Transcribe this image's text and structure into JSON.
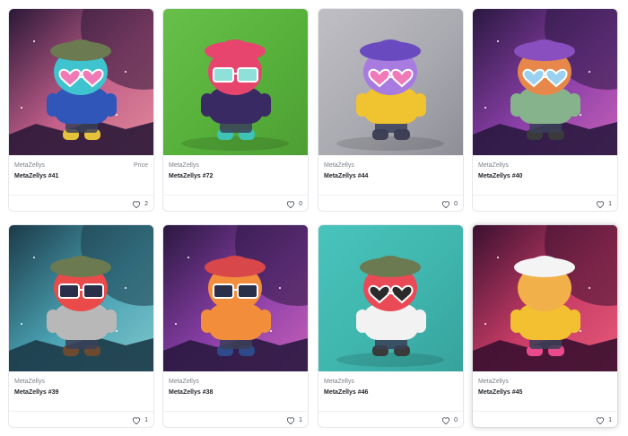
{
  "grid": {
    "price_label": "Price",
    "cards": [
      {
        "collection": "MetaZellys",
        "name": "MetaZellys #41",
        "likes": "2",
        "bg": "space-pink",
        "hat": "#6b7a50",
        "skin": "#3ec3cf",
        "top": "#2f56b8",
        "glasses": "heart-pink",
        "shoes": "#e5c23a"
      },
      {
        "collection": "MetaZellys",
        "name": "MetaZellys #72",
        "likes": "0",
        "bg": "green",
        "hat": "#e8456e",
        "skin": "#e8456e",
        "top": "#3a2a63",
        "glasses": "square-mint",
        "shoes": "#3ec3b5"
      },
      {
        "collection": "MetaZellys",
        "name": "MetaZellys #44",
        "likes": "0",
        "bg": "grey",
        "hat": "#6a4bbf",
        "skin": "#a77be0",
        "top": "#f0c330",
        "glasses": "heart-pink",
        "shoes": "#3f3f55"
      },
      {
        "collection": "MetaZellys",
        "name": "MetaZellys #40",
        "likes": "1",
        "bg": "space-purple",
        "hat": "#8a4fbf",
        "skin": "#e7884a",
        "top": "#86b38c",
        "glasses": "heart-blue",
        "shoes": "#3a3a3a"
      },
      {
        "collection": "MetaZellys",
        "name": "MetaZellys #39",
        "likes": "1",
        "bg": "space-teal",
        "hat": "#6b7a50",
        "skin": "#ea4a4a",
        "top": "#b8b8b8",
        "glasses": "square-dark",
        "shoes": "#6b4a2f"
      },
      {
        "collection": "MetaZellys",
        "name": "MetaZellys #38",
        "likes": "1",
        "bg": "space-purple",
        "hat": "#d8474a",
        "skin": "#f28d3c",
        "top": "#f28d3c",
        "glasses": "square-dark",
        "shoes": "#2f4a8a"
      },
      {
        "collection": "MetaZellys",
        "name": "MetaZellys #46",
        "likes": "0",
        "bg": "teal",
        "hat": "#6b7a50",
        "skin": "#ea4a56",
        "top": "#f2f2f2",
        "glasses": "heart-dark",
        "shoes": "#3a3a3a"
      },
      {
        "collection": "MetaZellys",
        "name": "MetaZellys #45",
        "likes": "1",
        "bg": "space-red",
        "hat": "#f4f4f4",
        "skin": "#f2b04a",
        "top": "#f2c030",
        "glasses": "none",
        "shoes": "#e84a8a"
      }
    ]
  }
}
